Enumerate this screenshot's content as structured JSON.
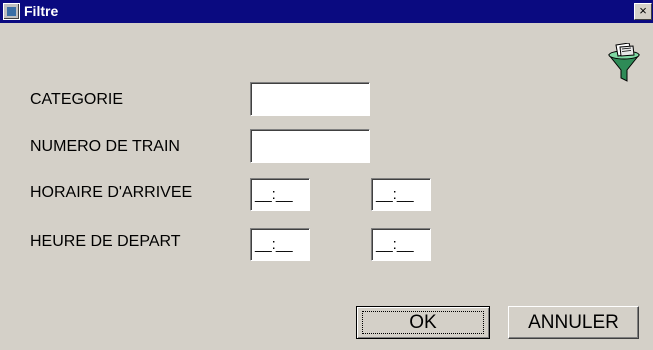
{
  "window": {
    "title": "Filtre",
    "close_label": "×"
  },
  "icons": {
    "app": "app-icon",
    "filter": "funnel-filter-icon"
  },
  "form": {
    "categorie": {
      "label": "CATEGORIE",
      "value": ""
    },
    "numero_de_train": {
      "label": "NUMERO DE TRAIN",
      "value": ""
    },
    "horaire_arrivee": {
      "label": "HORAIRE D'ARRIVEE",
      "from": "__:__",
      "to": "__:__"
    },
    "heure_depart": {
      "label": "HEURE DE DEPART",
      "from": "__:__",
      "to": "__:__"
    }
  },
  "buttons": {
    "ok": "OK",
    "annuler": "ANNULER"
  },
  "colors": {
    "titlebar": "#0a0a80",
    "face": "#d4d0c8"
  }
}
